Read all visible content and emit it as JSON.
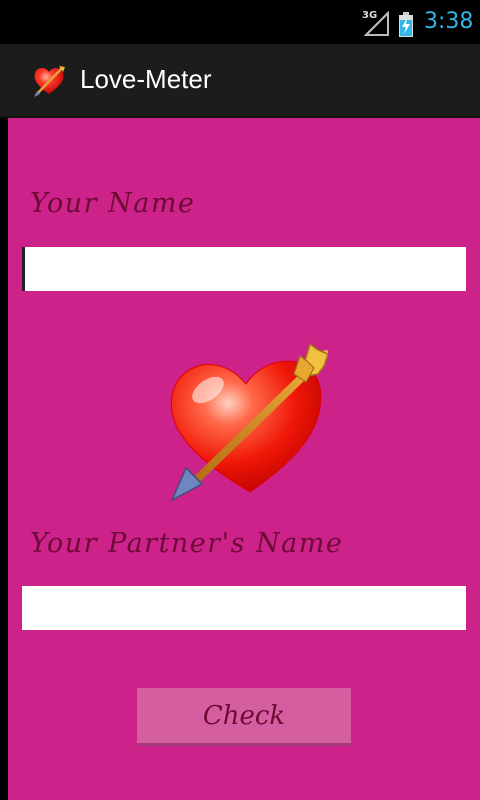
{
  "status_bar": {
    "network_label": "3G",
    "time": "3:38",
    "accent_color": "#33b5e5",
    "icons": [
      "signal-icon",
      "battery-charging-icon"
    ]
  },
  "action_bar": {
    "title": "Love-Meter",
    "icon": "heart-arrow-icon"
  },
  "form": {
    "your_name_label": "Your Name",
    "your_name_value": "",
    "partner_name_label": "Your Partner's Name",
    "partner_name_value": "",
    "check_button_label": "Check"
  },
  "colors": {
    "background": "#cc228a",
    "label_text": "#6d0b35",
    "button": "#d45e9f",
    "action_bar": "#1c1c1c"
  },
  "graphic": {
    "icon": "heart-with-arrow-icon"
  }
}
